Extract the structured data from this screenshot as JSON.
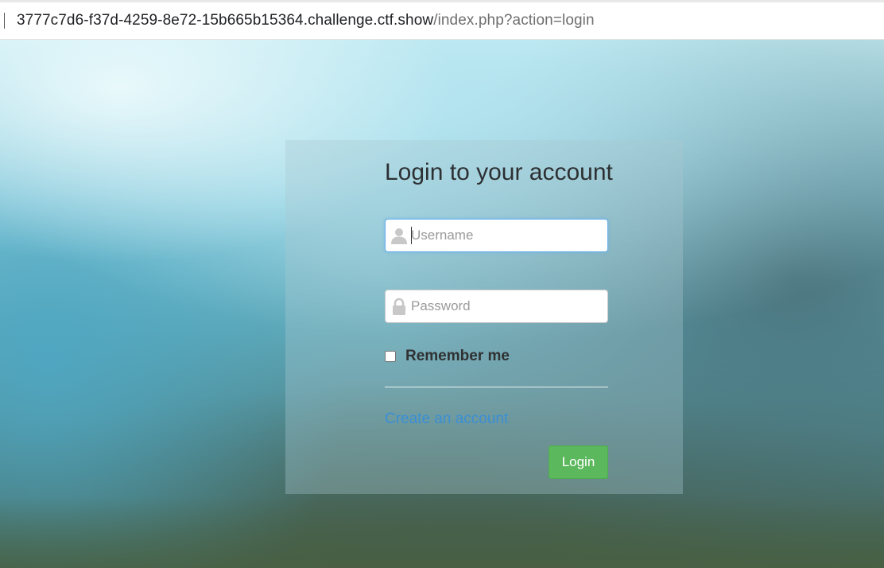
{
  "browser": {
    "url_host": "3777c7d6-f37d-4259-8e72-15b665b15364.challenge.ctf.show",
    "url_path": "/index.php?action=login"
  },
  "login": {
    "title": "Login to your account",
    "username_placeholder": "Username",
    "password_placeholder": "Password",
    "remember_label": "Remember me",
    "remember_checked": false,
    "create_account_link": "Create an account",
    "login_button": "Login",
    "icons": {
      "username": "user-icon",
      "password": "lock-icon"
    }
  },
  "colors": {
    "button_green": "#5cb85c",
    "link_blue": "#3a8fd6",
    "focus_blue": "#66afe9"
  }
}
